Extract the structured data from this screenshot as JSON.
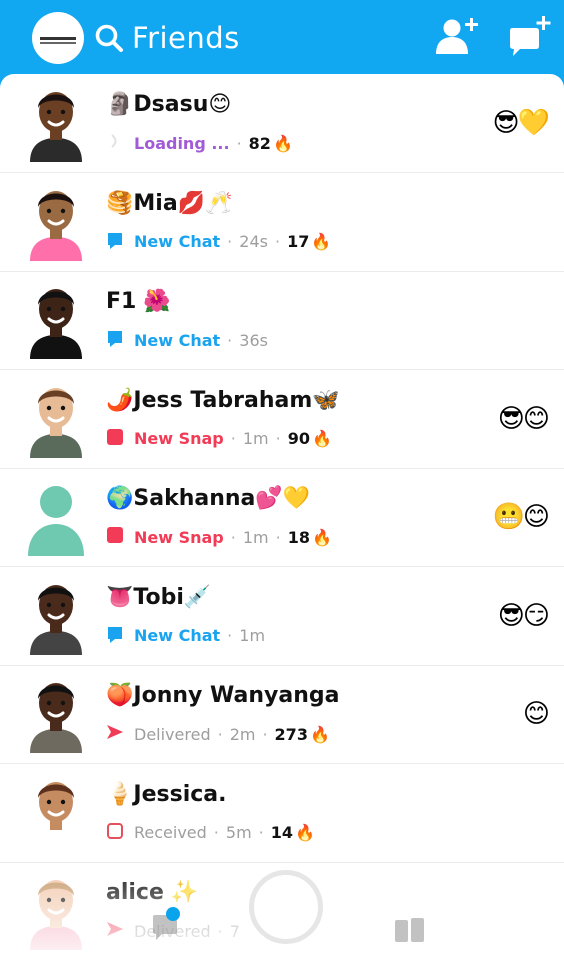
{
  "header": {
    "title": "Friends",
    "search_icon": "search-icon",
    "add_friend_icon": "add-friend-icon",
    "new_chat_icon": "new-chat-icon"
  },
  "colors": {
    "header_bg": "#12a8f1",
    "chat_blue": "#1aa3ef",
    "snap_red": "#f23c57",
    "loading_purple": "#a25ad6",
    "received_red": "#e4505e"
  },
  "friends": [
    {
      "name": "Dsasu",
      "name_prefix": "🗿",
      "name_suffix": "😊",
      "status": "Loading ...",
      "status_type": "loading",
      "time": "",
      "streak": "82",
      "fire": "🔥",
      "badges": "😎💛"
    },
    {
      "name": "Mia",
      "name_prefix": "🥞",
      "name_suffix": "💋🥂",
      "status": "New Chat",
      "status_type": "chat",
      "time": "24s",
      "streak": "17",
      "fire": "🔥",
      "badges": ""
    },
    {
      "name": "F1",
      "name_prefix": "",
      "name_suffix": " 🌺",
      "status": "New Chat",
      "status_type": "chat",
      "time": "36s",
      "streak": "",
      "fire": "",
      "badges": ""
    },
    {
      "name": "Jess Tabraham",
      "name_prefix": "🌶️",
      "name_suffix": "🦋",
      "status": "New Snap",
      "status_type": "snap",
      "time": "1m",
      "streak": "90",
      "fire": "🔥",
      "badges": "😎😊"
    },
    {
      "name": "Sakhanna",
      "name_prefix": "🌍",
      "name_suffix": "💕💛",
      "status": "New Snap",
      "status_type": "snap",
      "time": "1m",
      "streak": "18",
      "fire": "🔥",
      "badges": "😬😊"
    },
    {
      "name": "Tobi",
      "name_prefix": "👅",
      "name_suffix": "💉",
      "status": "New Chat",
      "status_type": "chat",
      "time": "1m",
      "streak": "",
      "fire": "",
      "badges": "😎😏"
    },
    {
      "name": "Jonny Wanyanga",
      "name_prefix": "🍑",
      "name_suffix": "",
      "status": "Delivered",
      "status_type": "delivered",
      "time": "2m",
      "streak": "273",
      "fire": "🔥",
      "badges": "😊"
    },
    {
      "name": "Jessica.",
      "name_prefix": "🍦",
      "name_suffix": "",
      "status": "Received",
      "status_type": "received",
      "time": "5m",
      "streak": "14",
      "fire": "🔥",
      "badges": ""
    },
    {
      "name": "alice",
      "name_prefix": "",
      "name_suffix": " ✨",
      "status": "Delivered",
      "status_type": "delivered",
      "time": "7",
      "streak": "",
      "fire": "",
      "badges": ""
    }
  ],
  "bottom_nav": {
    "chat_icon": "chat-icon",
    "camera_icon": "camera-shutter-icon",
    "stories_icon": "stories-icon"
  }
}
